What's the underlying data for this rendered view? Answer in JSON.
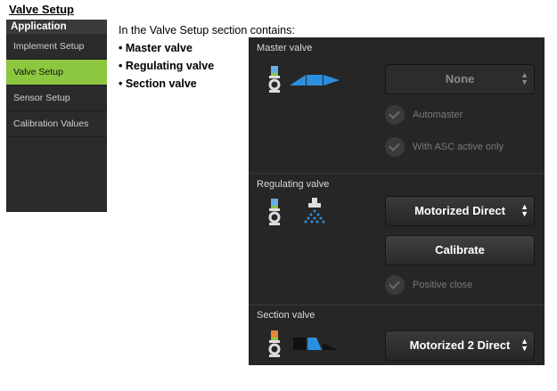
{
  "doc": {
    "title": "Valve Setup",
    "intro": "In the Valve Setup section contains:",
    "bullets": [
      "• Master valve",
      "• Regulating valve",
      "• Section valve"
    ]
  },
  "sidebar": {
    "header": "Application",
    "items": [
      {
        "label": "Implement Setup"
      },
      {
        "label": "Valve Setup"
      },
      {
        "label": "Sensor Setup"
      },
      {
        "label": "Calibration Values"
      }
    ]
  },
  "panel": {
    "master": {
      "title": "Master valve",
      "dropdown": "None",
      "options": [
        "Automaster",
        "With ASC active only"
      ]
    },
    "regulating": {
      "title": "Regulating valve",
      "dropdown": "Motorized Direct",
      "calibrate": "Calibrate",
      "option": "Positive close"
    },
    "section": {
      "title": "Section valve",
      "dropdown": "Motorized 2 Direct"
    }
  },
  "colors": {
    "accent_green": "#8dc63f",
    "icon_blue": "#2b8fe0",
    "panel_bg": "#262626"
  },
  "icons": [
    "valve-icon",
    "spray-boom-icon",
    "spray-nozzle-icon",
    "section-boom-icon",
    "checkmark-icon",
    "updown-arrow-icon"
  ]
}
